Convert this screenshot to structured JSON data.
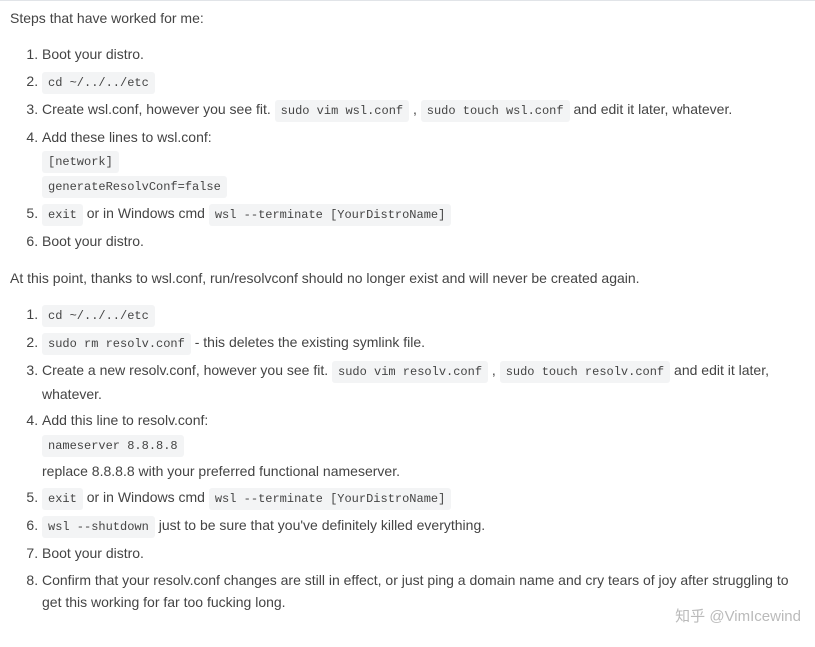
{
  "intro": "Steps that have worked for me:",
  "list1": {
    "i1": "Boot your distro.",
    "i2_code": "cd ~/../../etc",
    "i3_pre": "Create wsl.conf, however you see fit. ",
    "i3_code1": "sudo vim wsl.conf",
    "i3_sep": " , ",
    "i3_code2": "sudo touch wsl.conf",
    "i3_post": " and edit it later, whatever.",
    "i4": "Add these lines to wsl.conf:",
    "i4_code1": "[network]",
    "i4_code2": "generateResolvConf=false",
    "i5_code1": "exit",
    "i5_mid": " or in Windows cmd ",
    "i5_code2": "wsl --terminate [YourDistroName]",
    "i6": "Boot your distro."
  },
  "middle": "At this point, thanks to wsl.conf, run/resolvconf should no longer exist and will never be created again.",
  "list2": {
    "i1_code": "cd ~/../../etc",
    "i2_code": "sudo rm resolv.conf",
    "i2_post": " - this deletes the existing symlink file.",
    "i3_pre": "Create a new resolv.conf, however you see fit. ",
    "i3_code1": "sudo vim resolv.conf",
    "i3_sep": " , ",
    "i3_code2": "sudo touch resolv.conf",
    "i3_post": " and edit it later, whatever.",
    "i4": "Add this line to resolv.conf:",
    "i4_code": "nameserver 8.8.8.8",
    "i4_sub": "replace 8.8.8.8 with your preferred functional nameserver.",
    "i5_code1": "exit",
    "i5_mid": " or in Windows cmd ",
    "i5_code2": "wsl --terminate [YourDistroName]",
    "i6_code": "wsl --shutdown",
    "i6_post": " just to be sure that you've definitely killed everything.",
    "i7": "Boot your distro.",
    "i8": "Confirm that your resolv.conf changes are still in effect, or just ping a domain name and cry tears of joy after struggling to get this working for far too fucking long."
  },
  "watermark": "知乎 @VimIcewind"
}
